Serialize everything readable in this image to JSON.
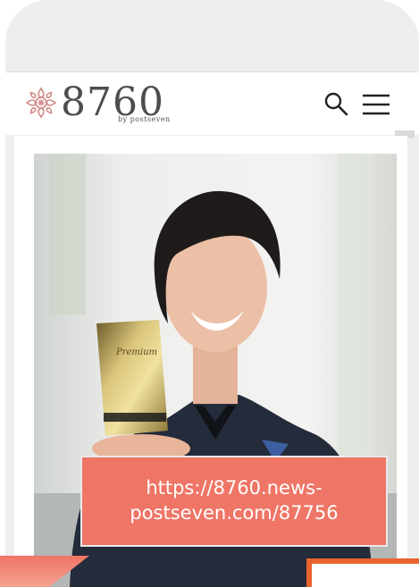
{
  "header": {
    "logo_number": "8760",
    "logo_sub": "by postseven",
    "brand_color": "#d18a87",
    "icons": [
      "search-icon",
      "menu-icon"
    ]
  },
  "overlay": {
    "url_line1": "https://8760.news-",
    "url_line2": "postseven.com/87756",
    "bg_color": "#ef7566"
  },
  "footer_accent_color": "#e8632f"
}
